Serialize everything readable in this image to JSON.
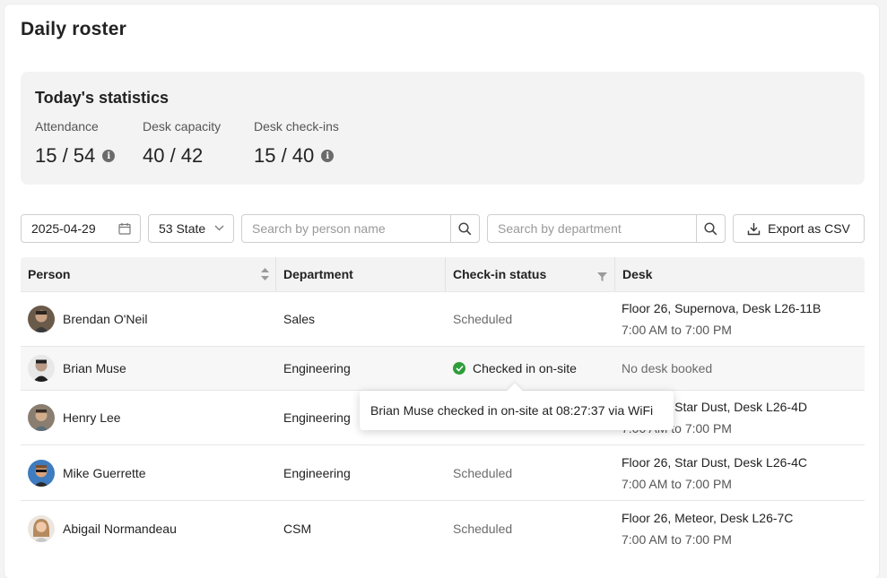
{
  "page": {
    "title": "Daily roster"
  },
  "stats": {
    "title": "Today's statistics",
    "items": [
      {
        "label": "Attendance",
        "value": "15 / 54",
        "info": true
      },
      {
        "label": "Desk capacity",
        "value": "40 / 42",
        "info": false
      },
      {
        "label": "Desk check-ins",
        "value": "15 / 40",
        "info": true
      }
    ]
  },
  "toolbar": {
    "date": "2025-04-29",
    "location": "53 State",
    "person_search_placeholder": "Search by person name",
    "department_search_placeholder": "Search by department",
    "export_label": "Export as CSV"
  },
  "table": {
    "headers": [
      "Person",
      "Department",
      "Check-in status",
      "Desk"
    ],
    "rows": [
      {
        "name": "Brendan O'Neil",
        "department": "Sales",
        "status": "Scheduled",
        "checked_in": false,
        "desk": "Floor 26, Supernova, Desk L26-11B",
        "time": "7:00 AM to 7:00 PM"
      },
      {
        "name": "Brian Muse",
        "department": "Engineering",
        "status": "Checked in on-site",
        "checked_in": true,
        "desk": "No desk booked",
        "time": ""
      },
      {
        "name": "Henry Lee",
        "department": "Engineering",
        "status": "",
        "checked_in": false,
        "desk": "Floor 26, Star Dust, Desk L26-4D",
        "time": "7:00 AM to 7:00 PM"
      },
      {
        "name": "Mike Guerrette",
        "department": "Engineering",
        "status": "Scheduled",
        "checked_in": false,
        "desk": "Floor 26, Star Dust, Desk L26-4C",
        "time": "7:00 AM to 7:00 PM"
      },
      {
        "name": "Abigail Normandeau",
        "department": "CSM",
        "status": "Scheduled",
        "checked_in": false,
        "desk": "Floor 26, Meteor, Desk L26-7C",
        "time": "7:00 AM to 7:00 PM"
      }
    ]
  },
  "tooltip": {
    "text": "Brian Muse checked in on-site at 08:27:37 via WiFi"
  },
  "colors": {
    "success": "#2e9d3a",
    "panel": "#f3f3f3"
  }
}
